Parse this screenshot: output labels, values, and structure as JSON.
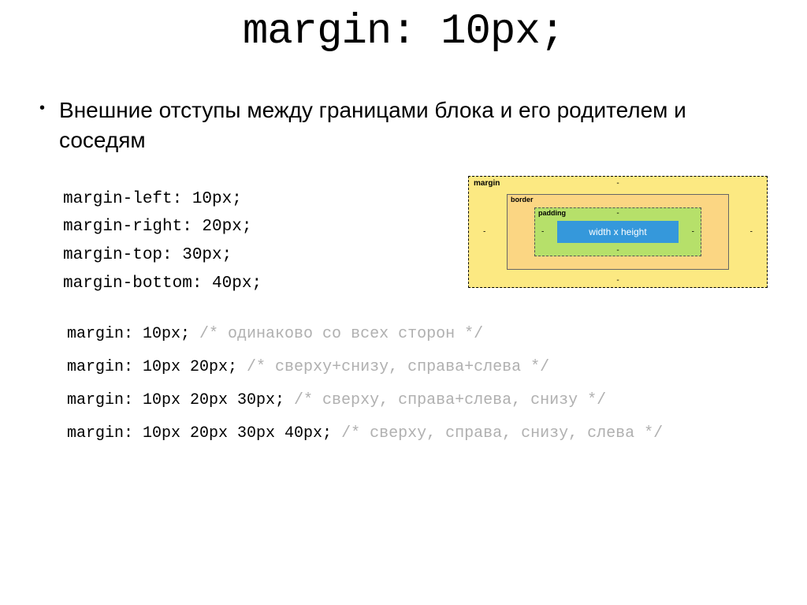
{
  "title": "margin: 10px;",
  "description": "Внешние отступы между границами блока и его родителем и соседям",
  "code_lines": {
    "l1": "margin-left: 10px;",
    "l2": "margin-right: 20px;",
    "l3": "margin-top: 30px;",
    "l4": "margin-bottom: 40px;"
  },
  "box_model": {
    "margin_label": "MARGIN",
    "border_label": "BORDER",
    "padding_label": "padding",
    "content_label": "width x height",
    "dash": "-"
  },
  "shorthand": {
    "s1_code": "margin: 10px;",
    "s1_comment": " /* одинаково со всех сторон */",
    "s2_code": "margin: 10px 20px;",
    "s2_comment": " /* сверху+снизу, справа+слева */",
    "s3_code": "margin: 10px 20px 30px;",
    "s3_comment": " /* сверху, справа+слева, снизу */",
    "s4_code": "margin: 10px 20px 30px 40px;",
    "s4_comment": " /* сверху, справа, снизу, слева */"
  }
}
